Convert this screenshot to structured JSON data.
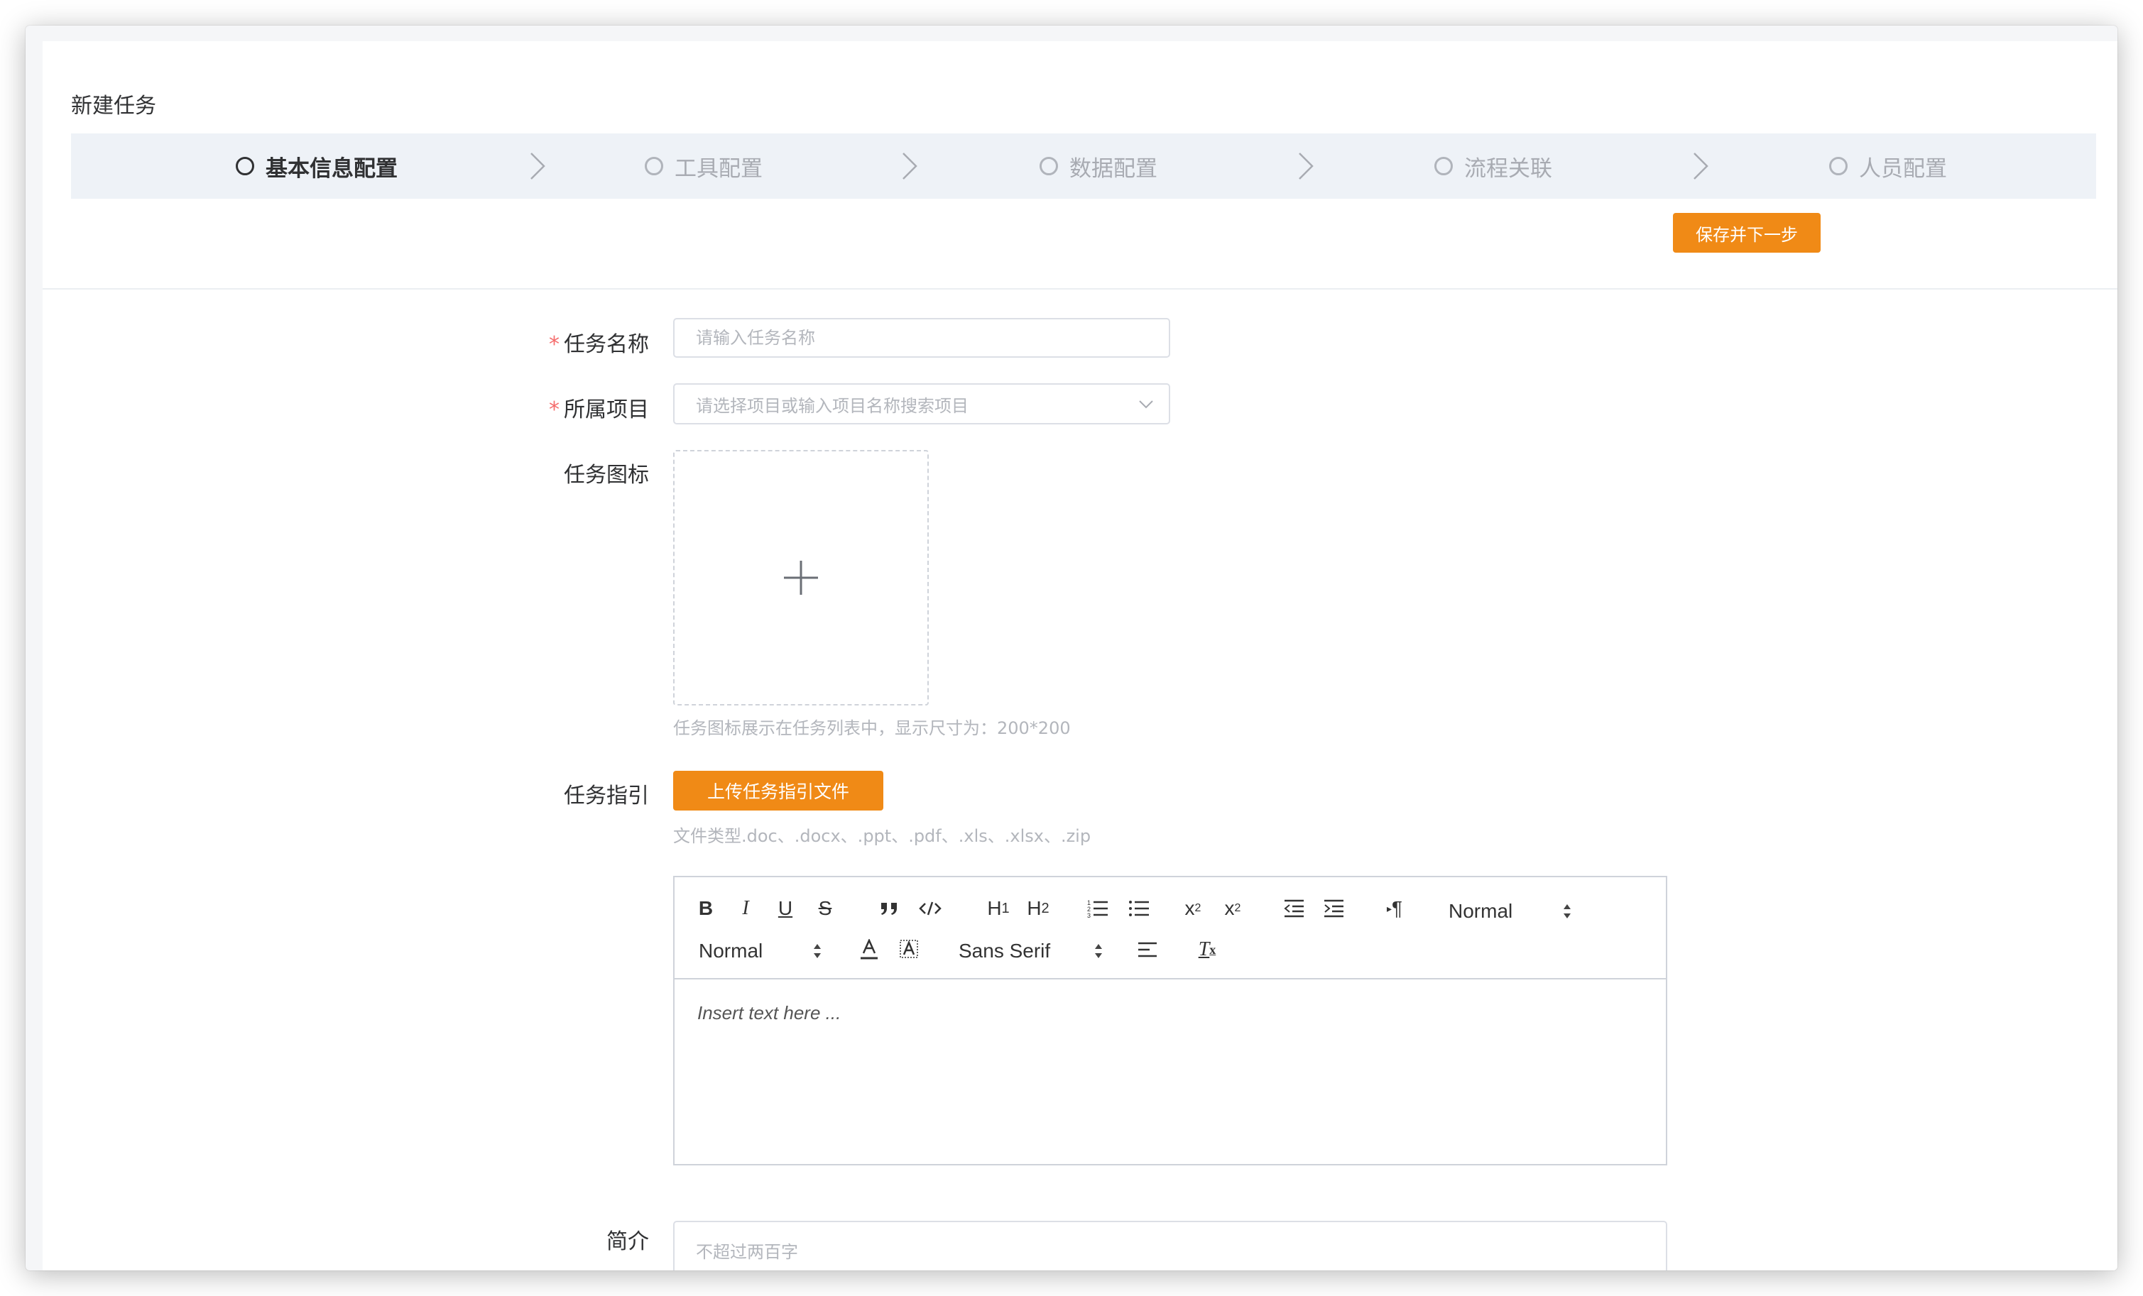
{
  "page": {
    "title": "新建任务"
  },
  "steps": [
    {
      "label": "基本信息配置",
      "active": true
    },
    {
      "label": "工具配置",
      "active": false
    },
    {
      "label": "数据配置",
      "active": false
    },
    {
      "label": "流程关联",
      "active": false
    },
    {
      "label": "人员配置",
      "active": false
    }
  ],
  "actions": {
    "save_next": "保存并下一步"
  },
  "form": {
    "task_name": {
      "label": "任务名称",
      "required": true,
      "placeholder": "请输入任务名称",
      "value": ""
    },
    "project": {
      "label": "所属项目",
      "required": true,
      "placeholder": "请选择项目或输入项目名称搜索项目"
    },
    "icon": {
      "label": "任务图标",
      "hint": "任务图标展示在任务列表中，显示尺寸为：200*200"
    },
    "guide": {
      "label": "任务指引",
      "upload_label": "上传任务指引文件",
      "hint": "文件类型.doc、.docx、.ppt、.pdf、.xls、.xlsx、.zip"
    },
    "editor": {
      "header_picker": "Normal",
      "size_picker": "Normal",
      "font_picker": "Sans Serif",
      "placeholder": "Insert text here ...",
      "tools": [
        "bold",
        "italic",
        "underline",
        "strike",
        "blockquote",
        "code-block",
        "header-1",
        "header-2",
        "ordered-list",
        "bullet-list",
        "subscript",
        "superscript",
        "outdent",
        "indent",
        "direction",
        "color",
        "background",
        "align",
        "clean"
      ]
    },
    "intro": {
      "label": "简介",
      "placeholder": "不超过两百字"
    }
  },
  "colors": {
    "accent": "#f08a16",
    "required": "#f56c6c",
    "step_bg": "#eef2f7"
  }
}
